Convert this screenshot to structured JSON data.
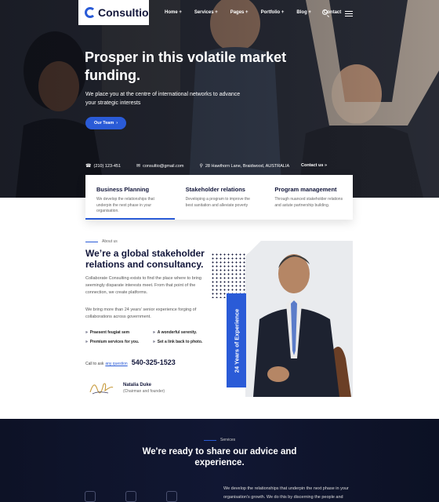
{
  "brand": {
    "logo_text": "Consultio",
    "accent": "#2a5bd7",
    "dark": "#12163a"
  },
  "nav": {
    "items": [
      "Home +",
      "Services +",
      "Pages +",
      "Portfolio +",
      "Blog +",
      "Contact"
    ],
    "search_icon": "search-icon",
    "menu_icon": "hamburger-icon"
  },
  "hero": {
    "title": "Prosper in this volatile market funding.",
    "subtitle": "We place you at the centre of international networks to advance your strategic interests",
    "button": "Our Team",
    "phone": "(210) 123-451",
    "email": "consultio@gmail.com",
    "address": "28 Hawthorn Lane, Braidwood, AUSTRALIA",
    "contact_link": "Contact us"
  },
  "cards": [
    {
      "title": "Business Planning",
      "text": "We develop the relationships that underpin the next phase in your organisation."
    },
    {
      "title": "Stakeholder relations",
      "text": "Developing a program to improve the best sanitation and alleviate poverty"
    },
    {
      "title": "Program management",
      "text": "Through nuanced stakeholder relations and astute partnership building."
    }
  ],
  "about": {
    "tag": "About us",
    "title": "We’re a global stakeholder relations and consultancy.",
    "p1": "Collaborate Consulting exists to find the place where to bring seemingly disparate interests meet. From that point of the connection, we create platforms.",
    "p2": "We bring more than 24 years’ senior experience forging of collaborations across government.",
    "checks": [
      "Praesent feugiat sem",
      "A wonderful serenity.",
      "Premium services for you.",
      "Set a link back to photo."
    ],
    "call_prefix": "Call to ask",
    "call_link": "any question",
    "phone": "540-325-1523",
    "person_name": "Natalia Duke",
    "person_role": "(Chairman and founder)",
    "experience": "24 Years of Experience"
  },
  "services": {
    "tag": "Services",
    "title": "We're ready to share our advice and experience.",
    "text": "We develop the relationships that underpin the next phase in your organisation's growth. We do this by discerning the people and"
  }
}
